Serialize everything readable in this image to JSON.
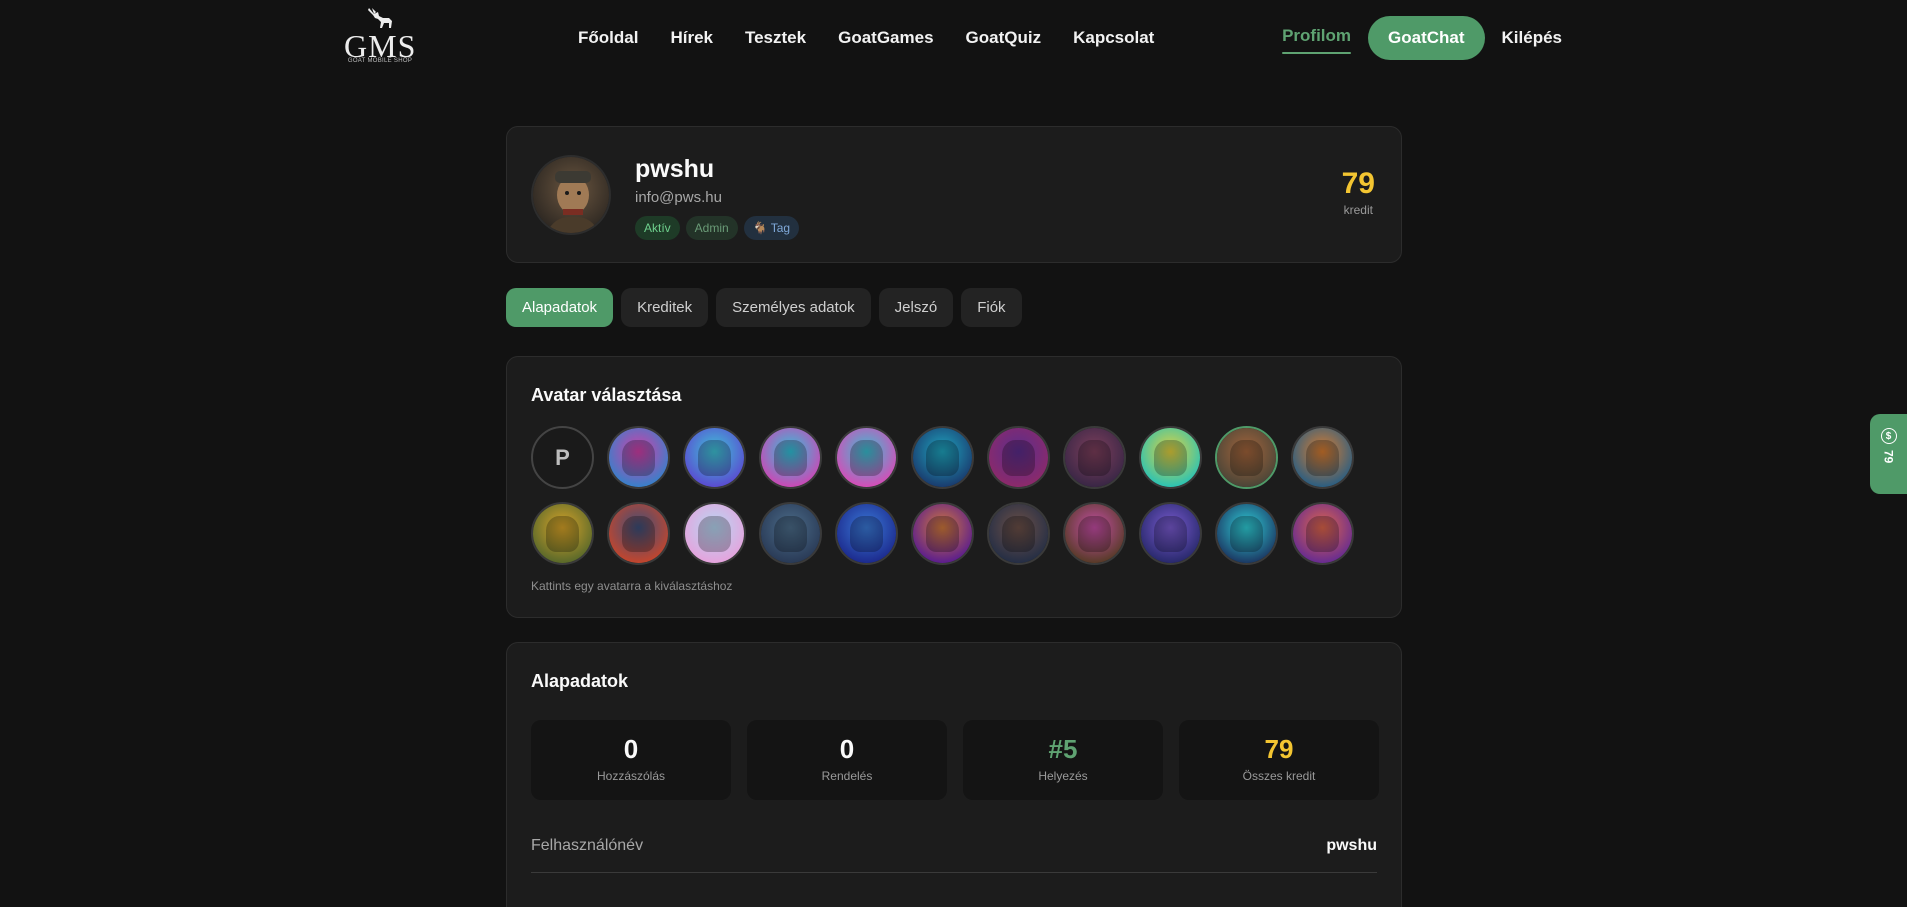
{
  "header": {
    "logo_text": "GMS",
    "logo_sub": "GOAT MOBILE SHOP",
    "nav": [
      "Főoldal",
      "Hírek",
      "Tesztek",
      "GoatGames",
      "GoatQuiz",
      "Kapcsolat"
    ],
    "profile_link": "Profilom",
    "chat_button": "GoatChat",
    "logout_link": "Kilépés"
  },
  "profile": {
    "username": "pwshu",
    "email": "info@pws.hu",
    "badges": {
      "active": "Aktív",
      "admin": "Admin",
      "member": "🐐 Tag"
    },
    "credit": "79",
    "credit_label": "kredit"
  },
  "tabs": [
    "Alapadatok",
    "Kreditek",
    "Személyes adatok",
    "Jelszó",
    "Fiók"
  ],
  "avatar_section": {
    "title": "Avatar választása",
    "letter_avatar": "P",
    "hint": "Kattints egy avatarra a kiválasztáshoz",
    "avatar_colors": [
      [
        "#3b7fc9",
        "#d23fa8"
      ],
      [
        "#5a4ed1",
        "#3ec4d6"
      ],
      [
        "#c74bb6",
        "#2fc3d9"
      ],
      [
        "#d24fb8",
        "#38c0d1"
      ],
      [
        "#1a3e70",
        "#1fa6c0"
      ],
      [
        "#8b2a6b",
        "#5a2d8c"
      ],
      [
        "#3b2746",
        "#7e3f5c"
      ],
      [
        "#2fc3b1",
        "#e5d13d"
      ],
      [
        "#4d4638",
        "#a5653b"
      ],
      [
        "#2f5f80",
        "#d97c2f"
      ],
      [
        "#5c6a2a",
        "#d9a429"
      ],
      [
        "#c0462f",
        "#3b4f7a"
      ],
      [
        "#e4a4dd",
        "#b6d8f3"
      ],
      [
        "#2a3b57",
        "#4c6d8a"
      ],
      [
        "#1d2c8f",
        "#3a7ad8"
      ],
      [
        "#5e1f8c",
        "#d27a3b"
      ],
      [
        "#262f45",
        "#6d5047"
      ],
      [
        "#5a3b2a",
        "#c64ea6"
      ],
      [
        "#2a2a6e",
        "#7a5bd1"
      ],
      [
        "#1c3c66",
        "#2fd0d9"
      ],
      [
        "#6a2d8f",
        "#e0664a"
      ]
    ]
  },
  "basic_section": {
    "title": "Alapadatok",
    "stats": [
      {
        "value": "0",
        "label": "Hozzászólás"
      },
      {
        "value": "0",
        "label": "Rendelés"
      },
      {
        "value": "#5",
        "label": "Helyezés"
      },
      {
        "value": "79",
        "label": "Összes kredit"
      }
    ],
    "fields": [
      {
        "label": "Felhasználónév",
        "value": "pwshu"
      }
    ]
  },
  "side_tab": {
    "credit": "79",
    "icon": "coin-icon"
  }
}
